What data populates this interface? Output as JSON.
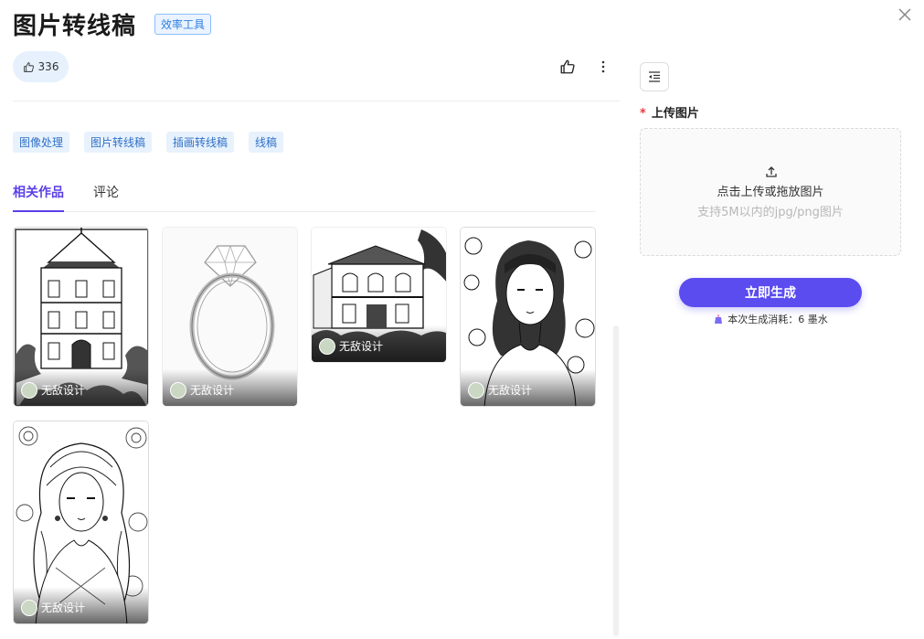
{
  "header": {
    "title": "图片转线稿",
    "badge": "效率工具"
  },
  "stats": {
    "likes": "336"
  },
  "tags": [
    "图像处理",
    "图片转线稿",
    "插画转线稿",
    "线稿"
  ],
  "tabs": [
    {
      "label": "相关作品",
      "active": true
    },
    {
      "label": "评论",
      "active": false
    }
  ],
  "works": [
    {
      "author": "无敌设计",
      "subject": "pagoda-building"
    },
    {
      "author": "无敌设计",
      "subject": "diamond-ring"
    },
    {
      "author": "无敌设计",
      "subject": "villa-house"
    },
    {
      "author": "无敌设计",
      "subject": "girl-with-flowers"
    },
    {
      "author": "无敌设计",
      "subject": "girl-with-ornaments"
    }
  ],
  "upload": {
    "label": "上传图片",
    "prompt": "点击上传或拖放图片",
    "hint": "支持5M以内的jpg/png图片"
  },
  "actions": {
    "generate_label": "立即生成",
    "cost_text": "本次生成消耗：6 墨水"
  },
  "colors": {
    "accent": "#5b4cf0",
    "tab_active": "#5b3fe8",
    "tag_text": "#2f6fc6",
    "tag_bg": "#e8f2fd",
    "required": "#e8383d"
  },
  "icons": {
    "close": "close-icon",
    "like": "thumbs-up-icon",
    "more": "more-vertical-icon",
    "panel": "indent-icon",
    "upload": "upload-icon",
    "cost": "ink-bottle-icon"
  }
}
